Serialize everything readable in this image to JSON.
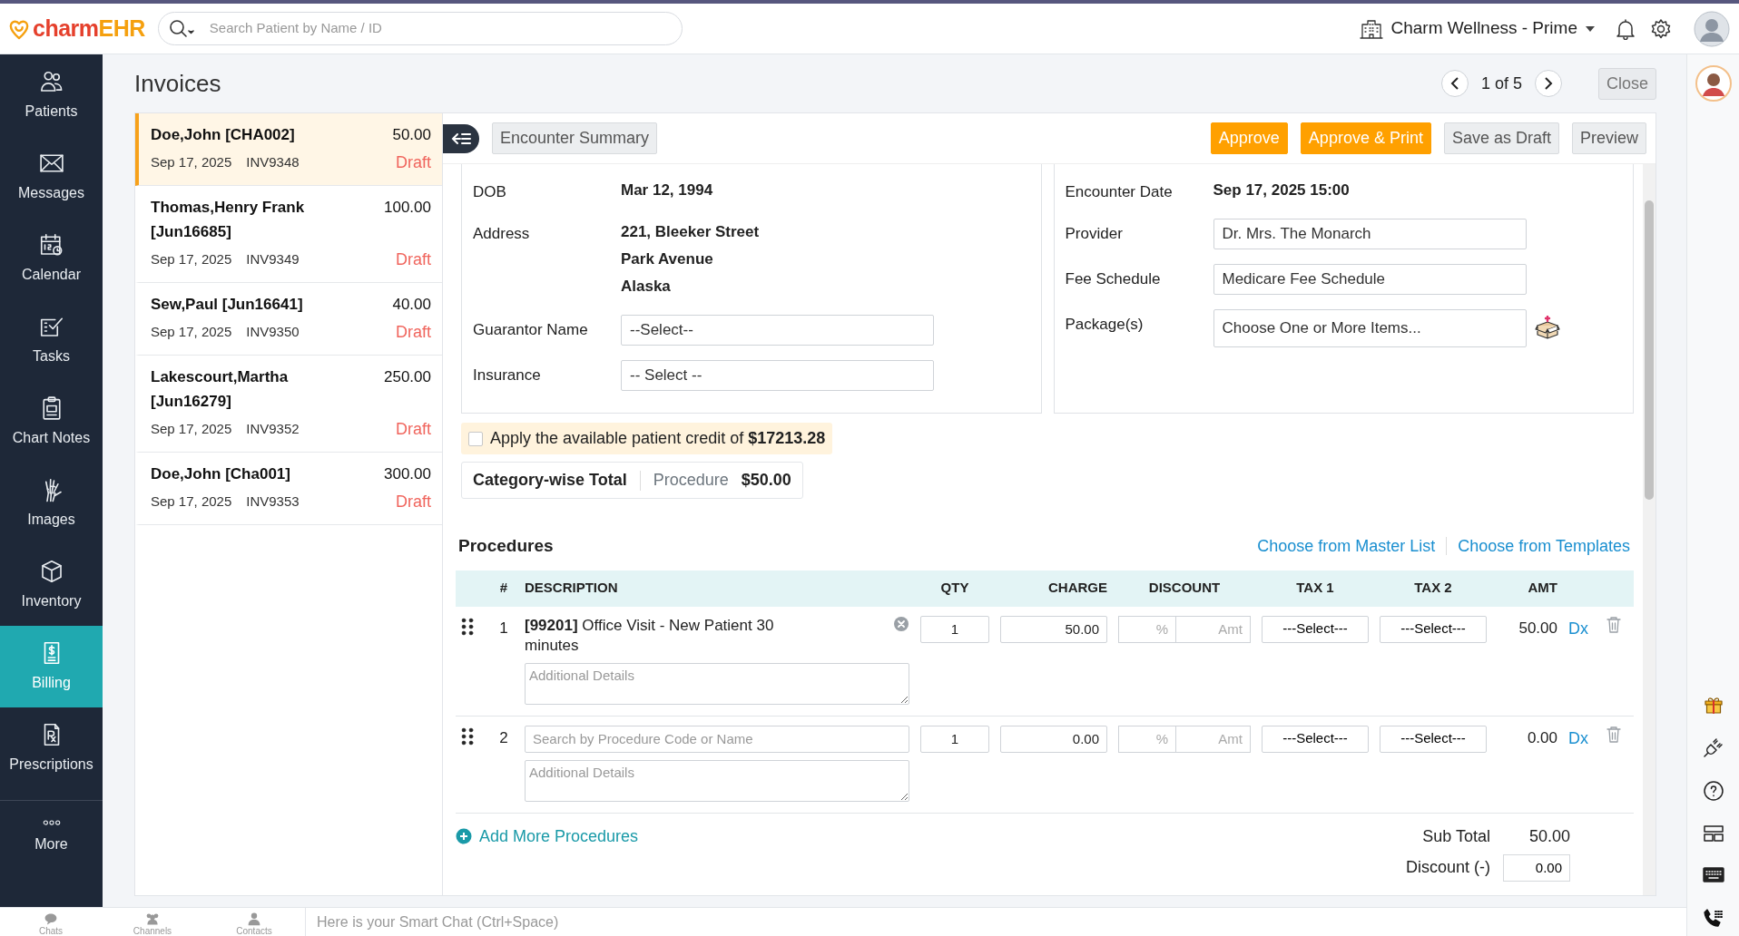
{
  "topbar": {
    "logo_first": "charm",
    "logo_second": "EHR",
    "search_placeholder": "Search Patient by Name / ID",
    "facility": "Charm Wellness - Prime"
  },
  "nav": [
    {
      "label": "Patients",
      "selected": false
    },
    {
      "label": "Messages",
      "selected": false
    },
    {
      "label": "Calendar",
      "selected": false
    },
    {
      "label": "Tasks",
      "selected": false
    },
    {
      "label": "Chart Notes",
      "selected": false
    },
    {
      "label": "Images",
      "selected": false
    },
    {
      "label": "Inventory",
      "selected": false
    },
    {
      "label": "Billing",
      "selected": true
    },
    {
      "label": "Prescriptions",
      "selected": false
    },
    {
      "label": "More",
      "selected": false
    }
  ],
  "page": {
    "title": "Invoices",
    "pager": "1 of 5",
    "close": "Close"
  },
  "invoices": [
    {
      "name": "Doe,John [CHA002]",
      "amount": "50.00",
      "date": "Sep 17, 2025",
      "number": "INV9348",
      "status": "Draft",
      "selected": true
    },
    {
      "name": "Thomas,Henry Frank [Jun16685]",
      "amount": "100.00",
      "date": "Sep 17, 2025",
      "number": "INV9349",
      "status": "Draft",
      "selected": false
    },
    {
      "name": "Sew,Paul [Jun16641]",
      "amount": "40.00",
      "date": "Sep 17, 2025",
      "number": "INV9350",
      "status": "Draft",
      "selected": false
    },
    {
      "name": "Lakescourt,Martha [Jun16279]",
      "amount": "250.00",
      "date": "Sep 17, 2025",
      "number": "INV9352",
      "status": "Draft",
      "selected": false
    },
    {
      "name": "Doe,John [Cha001]",
      "amount": "300.00",
      "date": "Sep 17, 2025",
      "number": "INV9353",
      "status": "Draft",
      "selected": false
    }
  ],
  "toolbar": {
    "summary": "Encounter Summary",
    "buttons": [
      {
        "label": "Approve",
        "kind": "primary"
      },
      {
        "label": "Approve & Print",
        "kind": "primary"
      },
      {
        "label": "Save as Draft",
        "kind": "secondary"
      },
      {
        "label": "Preview",
        "kind": "secondary"
      }
    ]
  },
  "patient_fields": [
    {
      "label": "DOB",
      "kind": "text",
      "lines": [
        "Mar 12, 1994"
      ]
    },
    {
      "label": "Address",
      "kind": "text",
      "lines": [
        "221, Bleeker Street",
        "Park Avenue",
        "Alaska"
      ]
    },
    {
      "label": "Guarantor Name",
      "kind": "select",
      "value": "--Select--"
    },
    {
      "label": "Insurance",
      "kind": "select",
      "value": "-- Select --"
    }
  ],
  "encounter_fields": [
    {
      "label": "Encounter Date",
      "kind": "text",
      "lines": [
        "Sep 17, 2025 15:00"
      ]
    },
    {
      "label": "Provider",
      "kind": "input",
      "value": "Dr. Mrs. The Monarch"
    },
    {
      "label": "Fee Schedule",
      "kind": "input",
      "value": "Medicare Fee Schedule"
    },
    {
      "label": "Package(s)",
      "kind": "multi",
      "value": "Choose One or More Items..."
    }
  ],
  "credit": {
    "checked": false,
    "text": "Apply the available patient credit of **$17213.28**"
  },
  "category_total": {
    "label": "Category-wise Total",
    "category": "Procedure",
    "amount": "$50.00"
  },
  "procedures": {
    "title": "Procedures",
    "links": [
      "Choose from Master List",
      "Choose from Templates"
    ],
    "columns": [
      "#",
      "DESCRIPTION",
      "QTY",
      "CHARGE",
      "DISCOUNT",
      "TAX 1",
      "TAX 2",
      "AMT"
    ],
    "rows": [
      {
        "kind": "filled",
        "number": "1",
        "description": "**[99201]** Office Visit - New Patient 30 minutes",
        "details_placeholder": "Additional Details",
        "qty": "1",
        "charge": "50.00",
        "percent_placeholder": "%",
        "amount_placeholder": "Amt",
        "tax1": "---Select---",
        "tax2": "---Select---",
        "amount": "50.00",
        "dx": "Dx"
      },
      {
        "kind": "search",
        "number": "2",
        "search_placeholder": "Search by Procedure Code or Name",
        "details_placeholder": "Additional Details",
        "qty": "1",
        "charge": "0.00",
        "percent_placeholder": "%",
        "amount_placeholder": "Amt",
        "tax1": "---Select---",
        "tax2": "---Select---",
        "amount": "0.00",
        "dx": "Dx"
      }
    ],
    "add": "Add More Procedures",
    "sub_total_label": "Sub Total",
    "sub_total": "50.00",
    "discount_label": "Discount (-)",
    "discount": "0.00"
  },
  "chat_bar": {
    "tabs": [
      "Chats",
      "Channels",
      "Contacts"
    ],
    "placeholder": "Here is your Smart Chat (Ctrl+Space)"
  }
}
